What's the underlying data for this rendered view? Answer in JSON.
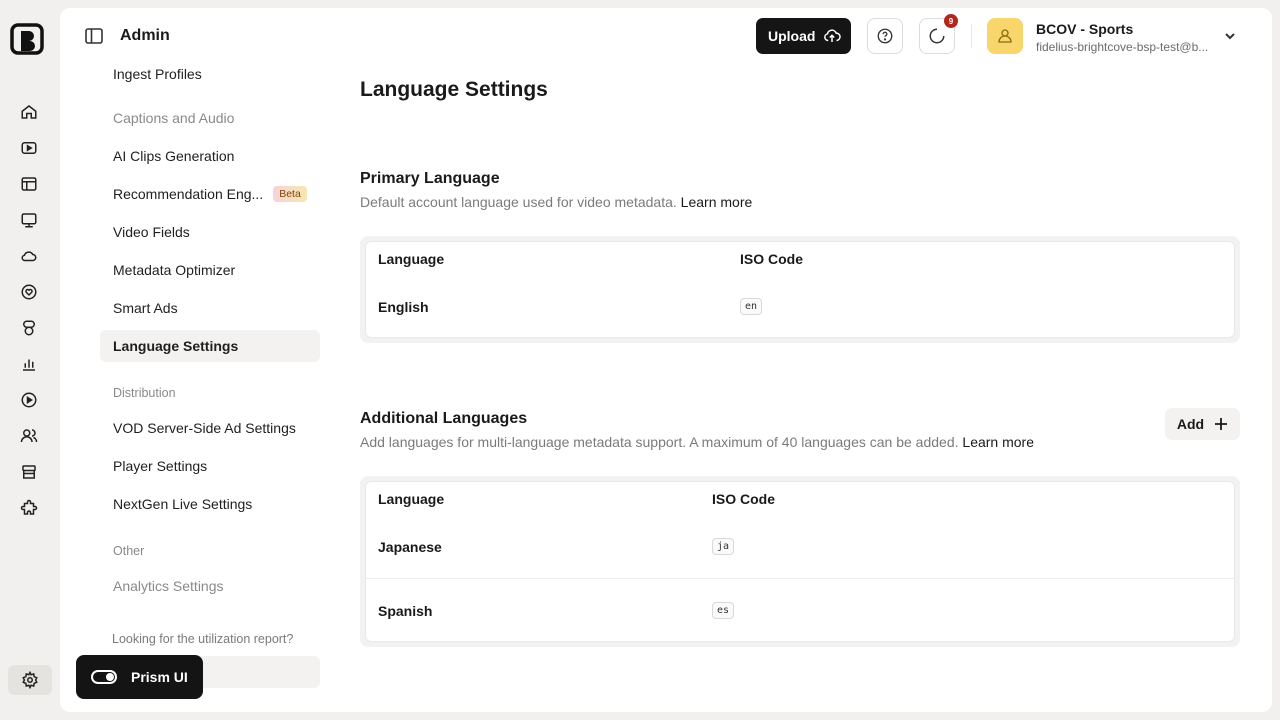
{
  "header": {
    "title": "Admin",
    "upload_label": "Upload",
    "notification_count": "9",
    "account_name": "BCOV - Sports",
    "account_email": "fidelius-brightcove-bsp-test@b..."
  },
  "sidebar": {
    "items_top": [
      {
        "label": "Ingest Profiles"
      },
      {
        "label": "Captions and Audio"
      },
      {
        "label": "AI Clips Generation"
      },
      {
        "label": "Recommendation Eng...",
        "badge": "Beta"
      },
      {
        "label": "Video Fields"
      },
      {
        "label": "Metadata Optimizer"
      },
      {
        "label": "Smart Ads"
      },
      {
        "label": "Language Settings"
      }
    ],
    "section_distribution": "Distribution",
    "items_distribution": [
      {
        "label": "VOD Server-Side Ad Settings"
      },
      {
        "label": "Player Settings"
      },
      {
        "label": "NextGen Live Settings"
      }
    ],
    "section_other": "Other",
    "items_other": [
      {
        "label": "Analytics Settings"
      }
    ],
    "utilization_note": "Looking for the utilization report?"
  },
  "main": {
    "page_title": "Language Settings",
    "primary": {
      "title": "Primary Language",
      "description": "Default account language used for video metadata.",
      "learn_more": "Learn more",
      "col_language": "Language",
      "col_iso": "ISO Code",
      "rows": [
        {
          "language": "English",
          "iso": "en"
        }
      ]
    },
    "additional": {
      "title": "Additional Languages",
      "description": "Add languages for multi-language metadata support. A maximum of 40 languages can be added.",
      "learn_more": "Learn more",
      "add_label": "Add",
      "col_language": "Language",
      "col_iso": "ISO Code",
      "rows": [
        {
          "language": "Japanese",
          "iso": "ja"
        },
        {
          "language": "Spanish",
          "iso": "es"
        }
      ]
    }
  },
  "prism_toggle": {
    "label": "Prism UI",
    "enabled": true
  },
  "colors": {
    "background": "#f1f0ee",
    "primary_button": "#151515",
    "avatar": "#f8d66b",
    "badge_red": "#b3261e"
  }
}
